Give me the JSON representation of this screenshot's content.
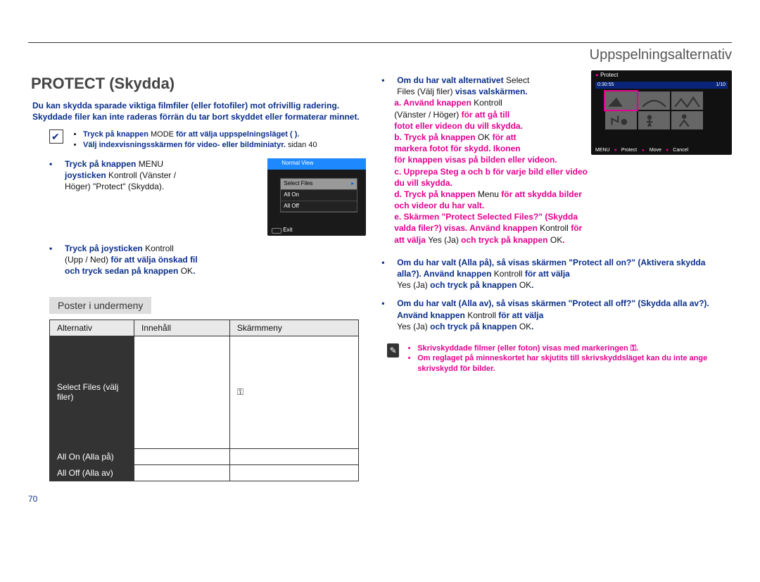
{
  "page": {
    "runningHead": "Uppspelningsalternativ",
    "number": "70"
  },
  "title": "PROTECT (Skydda)",
  "intro": "Du kan skydda sparade viktiga filmfiler (eller fotofiler) mot ofrivillig radering. Skyddade filer kan inte raderas förrän du tar bort skyddet eller formaterar minnet.",
  "modeNotes": {
    "a": {
      "pre": "Tryck på knappen ",
      "btn": "MODE",
      "post": " för att välja uppspelningsläget ( )."
    },
    "b": {
      "pre": "Välj indexvisningsskärmen för video- eller bildminiatyr. ",
      "ref": "sidan 40"
    }
  },
  "stepsLeft": {
    "s1": {
      "l1a": "Tryck på knappen ",
      "l1b": "MENU",
      "l1c": " ",
      "l2a": "joysticken",
      "l2b": " Kontroll",
      "l2c": " (Vänster /",
      "l3": "Höger)  \"Protect\" (Skydda)."
    },
    "s2": {
      "l1a": "Tryck på joysticken ",
      "l1b": "Kontroll",
      "l2a": "(Upp / Ned)",
      "l2b": " för att välja önskad fil",
      "l3a": "och tryck sedan på knappen ",
      "l3b": "OK",
      "l3c": "."
    }
  },
  "menuArt": {
    "title": "Normal View",
    "rows": [
      "Select Files",
      "All On",
      "All Off"
    ],
    "exit": "Exit"
  },
  "subhead": "Poster i undermeny",
  "table": {
    "headers": [
      "Alternativ",
      "Innehåll",
      "Skärmmeny"
    ],
    "rows": [
      {
        "opt": "Select Files (välj filer)",
        "mid": "",
        "right_icon": "key"
      },
      {
        "opt": "All On (Alla på)",
        "mid": "",
        "right_icon": ""
      },
      {
        "opt": "All Off (Alla av)",
        "mid": "",
        "right_icon": ""
      }
    ]
  },
  "thumbs": {
    "title": "Protect",
    "bar_left": "0:30:55",
    "bar_right": "1/10",
    "footer": {
      "menu": "MENU",
      "protect": "Protect",
      "move": "Move",
      "cancel": "Cancel"
    }
  },
  "right": {
    "p1": {
      "lead_a": "Om du har valt alternativet ",
      "lead_b": "Select",
      "lead_c_a": "Files (Välj filer)",
      "lead_c_b": " visas valskärmen.",
      "a1": "a. Använd knappen",
      "a1k": " Kontroll",
      "a2": "(Vänster / Höger)",
      "a2b": " för att gå till",
      "a3": "fotot eller videon du vill skydda.",
      "b1": "b. Tryck på knappen ",
      "b1k": "OK",
      "b1t": " för att",
      "b2": "markera fotot för skydd. Ikonen",
      "b3": "för knappen visas på bilden eller videon.",
      "c": "c. Upprepa Steg a och b för varje bild eller video du vill skydda.",
      "d1": "d. Tryck på knappen ",
      "d1k": "Menu",
      "d1t": " för att skydda bilder och videor du har valt.",
      "e1": "e. Skärmen \"Protect Selected Files?\" (Skydda valda filer?) visas. Använd knappen",
      "e1k": " Kontroll",
      "e1t": " för att välja ",
      "e1y": "Yes (Ja)",
      "e1o": " och tryck på knappen ",
      "e1ok": "OK",
      "e1dot": "."
    },
    "p2": {
      "t1": "Om du har valt (Alla på), så visas skärmen \"Protect all on?\" (Aktivera skydda alla?). Använd knappen",
      "k": " Kontroll",
      "t2": " för att välja ",
      "y": "Yes (Ja)",
      "t3": " och tryck på knappen ",
      "ok": "OK",
      "dot": "."
    },
    "p3": {
      "t1": "Om du har valt (Alla av), så visas skärmen \"Protect all off?\" (Skydda alla av?). Använd knappen",
      "k": " Kontroll",
      "t2": " för att välja ",
      "y": "Yes (Ja)",
      "t3": " och tryck på knappen ",
      "ok": "OK",
      "dot": "."
    },
    "footnotes": {
      "a": "Skrivskyddade filmer (eller foton) visas med markeringen ⚿.",
      "b": "Om reglaget på minneskortet har skjutits till skrivskyddsläget kan du inte ange skrivskydd för bilder."
    }
  }
}
